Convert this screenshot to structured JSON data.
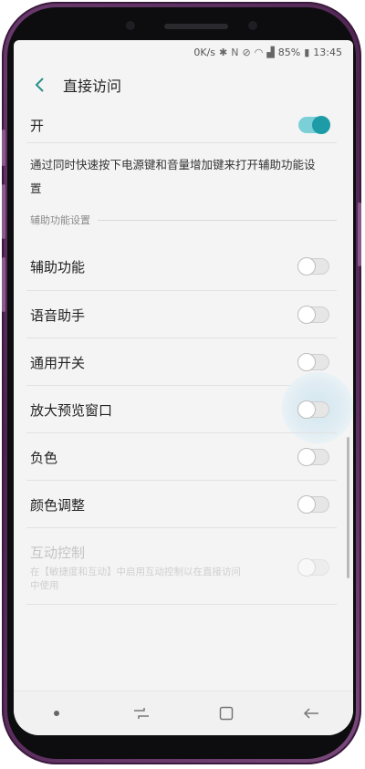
{
  "status_bar": {
    "network_speed": "0K/s",
    "battery": "85%",
    "time": "13:45",
    "icons": [
      "bluetooth-icon",
      "nfc-icon",
      "mute-icon",
      "wifi-icon",
      "signal-icon"
    ]
  },
  "header": {
    "title": "直接访问"
  },
  "main_toggle": {
    "label": "开",
    "on": true
  },
  "description": "通过同时快速按下电源键和音量增加键来打开辅助功能设置",
  "section_title": "辅助功能设置",
  "settings": [
    {
      "label": "辅助功能",
      "on": false
    },
    {
      "label": "语音助手",
      "on": false
    },
    {
      "label": "通用开关",
      "on": false
    },
    {
      "label": "放大预览窗口",
      "on": false
    },
    {
      "label": "负色",
      "on": false
    },
    {
      "label": "颜色调整",
      "on": false
    }
  ],
  "interaction_control": {
    "label": "互动控制",
    "sublabel": "在【敏捷度和互动】中启用互动控制以在直接访问中使用",
    "enabled": false
  },
  "accent_color": "#1d9ba6"
}
